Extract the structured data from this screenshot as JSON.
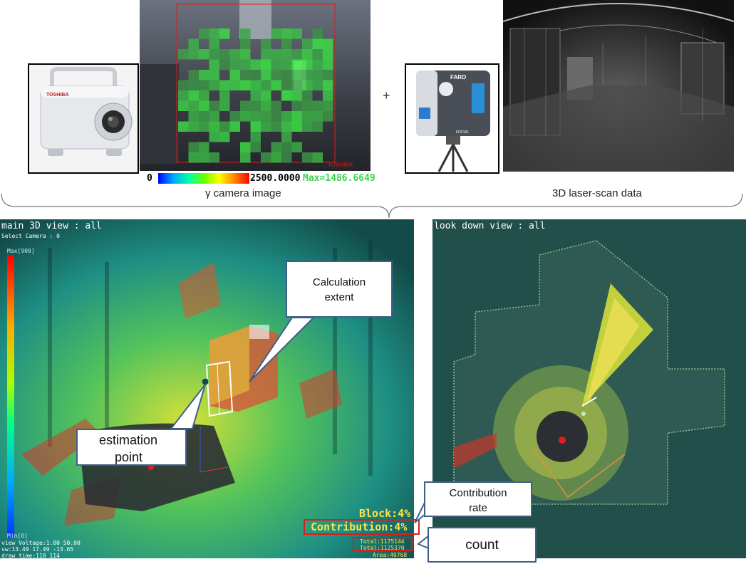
{
  "top": {
    "colorbar_min": "0",
    "colorbar_max": "2500.0000",
    "max_readout": "Max=1486.6649",
    "brand_on_image": "TOSHIBA",
    "brand_on_device": "TOSHIBA",
    "plus_sign": "+",
    "faro_brand": "FARO",
    "faro_model": "FOCUS",
    "gamma_caption": "γ camera image",
    "laser_caption": "3D laser-scan data"
  },
  "main_view": {
    "title": "main 3D view : all",
    "select_camera": "Select Camera : 0",
    "scale_max": "Max[900]",
    "scale_min": "Min[0]",
    "info_lines": [
      "view Voltage:1.00 50.00",
      "vw:13.49 17.49 -13.65",
      "draw time:110 114"
    ],
    "block": "Block:4%",
    "contribution": "Contribution:4%",
    "total1": "Total:1175144",
    "total2": "Total:1125370",
    "area": "Area:49768"
  },
  "side_view": {
    "title": "look down view : all"
  },
  "callouts": {
    "calc_extent": [
      "Calculation",
      "extent"
    ],
    "estimation": [
      "estimation",
      "point"
    ],
    "contribution_rate": [
      "Contribution",
      "rate"
    ],
    "count": "count"
  }
}
